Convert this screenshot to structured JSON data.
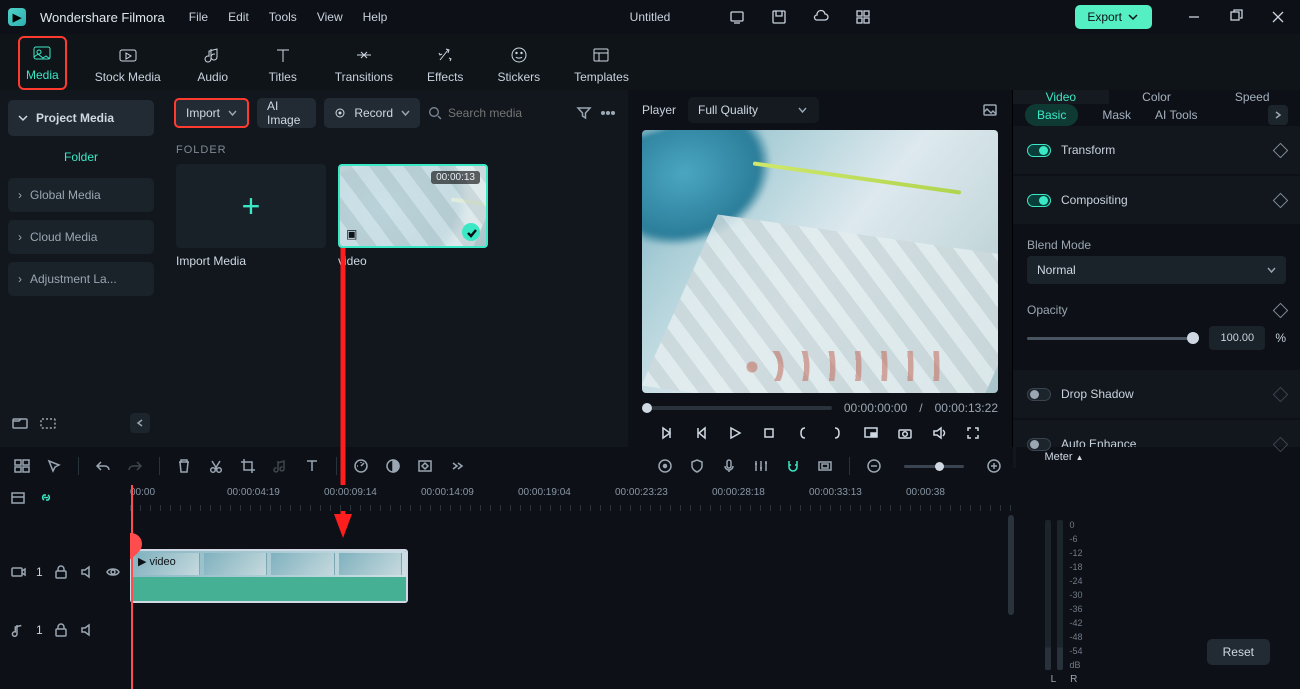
{
  "app": {
    "name": "Wondershare Filmora",
    "document": "Untitled"
  },
  "menu": {
    "file": "File",
    "edit": "Edit",
    "tools": "Tools",
    "view": "View",
    "help": "Help"
  },
  "titlebar": {
    "export": "Export"
  },
  "nav": {
    "media": "Media",
    "stock": "Stock Media",
    "audio": "Audio",
    "titles": "Titles",
    "transitions": "Transitions",
    "effects": "Effects",
    "stickers": "Stickers",
    "templates": "Templates"
  },
  "sidebar": {
    "project": "Project Media",
    "folder": "Folder",
    "global": "Global Media",
    "cloud": "Cloud Media",
    "adjust": "Adjustment La..."
  },
  "mediabar": {
    "import": "Import",
    "aiimage": "AI Image",
    "record": "Record",
    "search_placeholder": "Search media"
  },
  "media": {
    "folder_label": "FOLDER",
    "import_card": "Import Media",
    "clip_name": "video",
    "clip_dur": "00:00:13"
  },
  "player": {
    "label": "Player",
    "quality": "Full Quality",
    "current": "00:00:00:00",
    "sep": "/",
    "total": "00:00:13:22"
  },
  "props": {
    "tabs": {
      "video": "Video",
      "color": "Color",
      "speed": "Speed"
    },
    "subtabs": {
      "basic": "Basic",
      "mask": "Mask",
      "ai": "AI Tools"
    },
    "transform": "Transform",
    "compositing": "Compositing",
    "blend_label": "Blend Mode",
    "blend_value": "Normal",
    "opacity_label": "Opacity",
    "opacity_value": "100.00",
    "opacity_unit": "%",
    "drop": "Drop Shadow",
    "auto": "Auto Enhance",
    "reset": "Reset"
  },
  "timeline": {
    "ticks": [
      "00:00",
      "00:00:04:19",
      "00:00:09:14",
      "00:00:14:09",
      "00:00:19:04",
      "00:00:23:23",
      "00:00:28:18",
      "00:00:33:13",
      "00:00:38"
    ],
    "clip": "video",
    "track_v": "1",
    "track_a": "1"
  },
  "meter": {
    "title": "Meter",
    "scale": [
      "0",
      "-6",
      "-12",
      "-18",
      "-24",
      "-30",
      "-36",
      "-42",
      "-48",
      "-54",
      "dB"
    ],
    "l": "L",
    "r": "R"
  }
}
